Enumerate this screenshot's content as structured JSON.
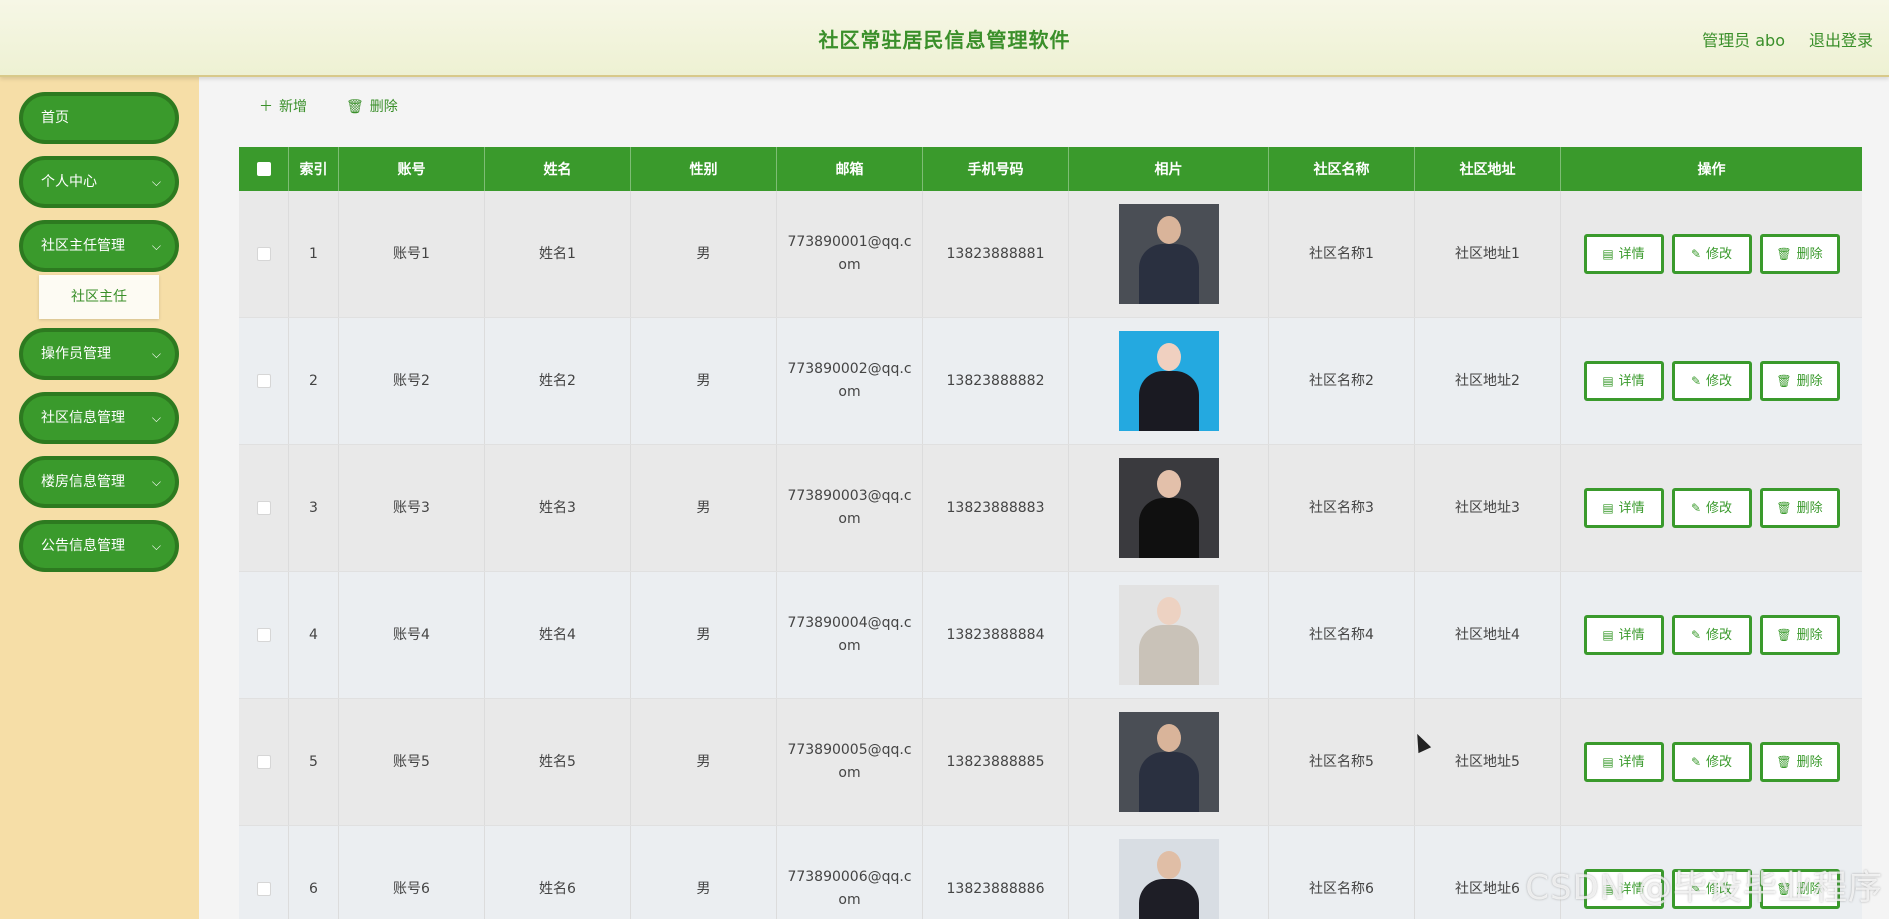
{
  "header": {
    "title": "社区常驻居民信息管理软件",
    "user": "管理员 abo",
    "logout": "退出登录"
  },
  "sidebar": {
    "items": [
      {
        "label": "首页",
        "chevron": false
      },
      {
        "label": "个人中心",
        "chevron": true
      },
      {
        "label": "社区主任管理",
        "chevron": true
      },
      {
        "label": "操作员管理",
        "chevron": true
      },
      {
        "label": "社区信息管理",
        "chevron": true
      },
      {
        "label": "楼房信息管理",
        "chevron": true
      },
      {
        "label": "公告信息管理",
        "chevron": true
      }
    ],
    "submenu_label": "社区主任"
  },
  "toolbar": {
    "add": "新增",
    "delete": "删除"
  },
  "table": {
    "headers": [
      "",
      "索引",
      "账号",
      "姓名",
      "性别",
      "邮箱",
      "手机号码",
      "相片",
      "社区名称",
      "社区地址",
      "操作"
    ],
    "rows": [
      {
        "index": "1",
        "account": "账号1",
        "name": "姓名1",
        "gender": "男",
        "email": "773890001@qq.com",
        "phone": "13823888881",
        "community": "社区名称1",
        "address": "社区地址1",
        "photo": {
          "bg": "#4a4e55",
          "skin": "#d9b49a",
          "suit": "#2a3040"
        }
      },
      {
        "index": "2",
        "account": "账号2",
        "name": "姓名2",
        "gender": "男",
        "email": "773890002@qq.com",
        "phone": "13823888882",
        "community": "社区名称2",
        "address": "社区地址2",
        "photo": {
          "bg": "#24a9e0",
          "skin": "#f0d0c0",
          "suit": "#1a1a22"
        }
      },
      {
        "index": "3",
        "account": "账号3",
        "name": "姓名3",
        "gender": "男",
        "email": "773890003@qq.com",
        "phone": "13823888883",
        "community": "社区名称3",
        "address": "社区地址3",
        "photo": {
          "bg": "#3a3a3e",
          "skin": "#e3c0aa",
          "suit": "#101010"
        }
      },
      {
        "index": "4",
        "account": "账号4",
        "name": "姓名4",
        "gender": "男",
        "email": "773890004@qq.com",
        "phone": "13823888884",
        "community": "社区名称4",
        "address": "社区地址4",
        "photo": {
          "bg": "#e2e2e2",
          "skin": "#edd2c2",
          "suit": "#c9c2b8"
        }
      },
      {
        "index": "5",
        "account": "账号5",
        "name": "姓名5",
        "gender": "男",
        "email": "773890005@qq.com",
        "phone": "13823888885",
        "community": "社区名称5",
        "address": "社区地址5",
        "photo": {
          "bg": "#4a4e55",
          "skin": "#d9b49a",
          "suit": "#2a3040"
        }
      },
      {
        "index": "6",
        "account": "账号6",
        "name": "姓名6",
        "gender": "男",
        "email": "773890006@qq.com",
        "phone": "13823888886",
        "community": "社区名称6",
        "address": "社区地址6",
        "photo": {
          "bg": "#d8dde3",
          "skin": "#e0bea6",
          "suit": "#1e1e26"
        }
      }
    ],
    "actions": {
      "detail": "详情",
      "edit": "修改",
      "delete": "删除"
    }
  },
  "watermark": "CSDN @毕设毕业程序",
  "colors": {
    "primary": "#3a9a2c",
    "sidebar": "#f6dea7",
    "title": "#3a8f2a"
  }
}
